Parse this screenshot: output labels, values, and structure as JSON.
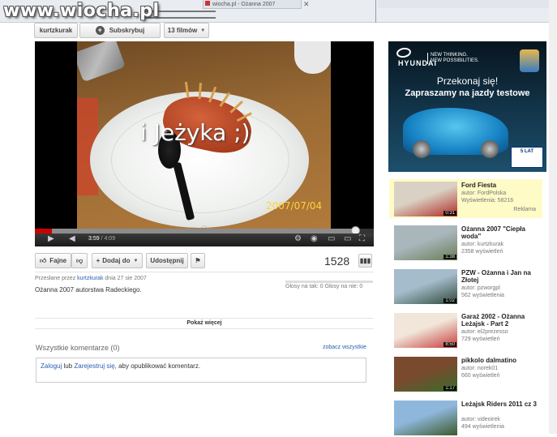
{
  "watermark": "www.wiocha.pl",
  "browser": {
    "tab_title": "wiocha.pl - Ożanna 2007"
  },
  "channel": {
    "username": "kurtzkurak",
    "subscribe_label": "Subskrybuj",
    "videos_label": "13 filmów"
  },
  "video": {
    "overlay_text": "i Jeżyka ;)",
    "date_stamp": "2007/07/04",
    "time_current": "3:59",
    "time_total": "/ 4:09",
    "played_fraction": 0.05,
    "loaded_fraction": 0.95,
    "position_fraction": 0.96
  },
  "actions": {
    "like_label": "Fajne",
    "add_label": "Dodaj do",
    "share_label": "Udostępnij",
    "views": "1528"
  },
  "info": {
    "posted_prefix": "Przesłane przez",
    "author": "kurtzkurak",
    "posted_suffix": "dnia 27 sie 2007",
    "description": "Ożanna 2007 autorstwa Radeckiego.",
    "votes": "Głosy na tak: 0  Głosy na nie: 0"
  },
  "show_more": "Pokaż więcej",
  "comments": {
    "header": "Wszystkie komentarze (0)",
    "see_all": "zobacz wszystkie",
    "login_link": "Zaloguj",
    "or_text": "lub",
    "register_link": "Zarejestruj się",
    "suffix": ", aby opublikować komentarz."
  },
  "ad": {
    "brand": "HYUNDAI",
    "tagline": "NEW THINKING.\nNEW POSSIBILITIES.",
    "headline": "Przekonaj się!",
    "subheadline": "Zapraszamy na jazdy testowe",
    "badge": "5 LAT"
  },
  "related": [
    {
      "title": "Ford Fiesta",
      "author": "autor: FordPolska",
      "views": "Wyświetlenia: 58216",
      "duration": "0:31",
      "tag": "Reklama",
      "colors": [
        "#d9d1c4",
        "#b02a24"
      ]
    },
    {
      "title": "Ożanna 2007 \"Ciepła woda\"",
      "author": "autor: kurtzkurak",
      "views": "2358 wyświetleń",
      "duration": "1:38",
      "tag": "",
      "colors": [
        "#a9b7bd",
        "#6b7d56"
      ]
    },
    {
      "title": "PZW - Ożanna i Jan na Złotej",
      "author": "autor: pzworgpl",
      "views": "562 wyświetlenia",
      "duration": "1:02",
      "tag": "",
      "colors": [
        "#a5bccc",
        "#2f4a3a"
      ]
    },
    {
      "title": "Garaż 2002 - Ożanna Leżajsk - Part 2",
      "author": "autor: el2prezesso",
      "views": "729 wyświetleń",
      "duration": "8:50",
      "tag": "",
      "colors": [
        "#f1e6d9",
        "#c63a3a"
      ]
    },
    {
      "title": "pikkolo dalmatino",
      "author": "autor: norek01",
      "views": "660 wyświetleń",
      "duration": "1:17",
      "tag": "",
      "colors": [
        "#7a4a2e",
        "#3b6b2c"
      ]
    },
    {
      "title": "Leżajsk Riders 2011 cz 3",
      "author": "autor: videoirek",
      "views": "494 wyświetlenia",
      "duration": "",
      "tag": "",
      "colors": [
        "#8fb7dc",
        "#3c5a2a"
      ]
    }
  ]
}
